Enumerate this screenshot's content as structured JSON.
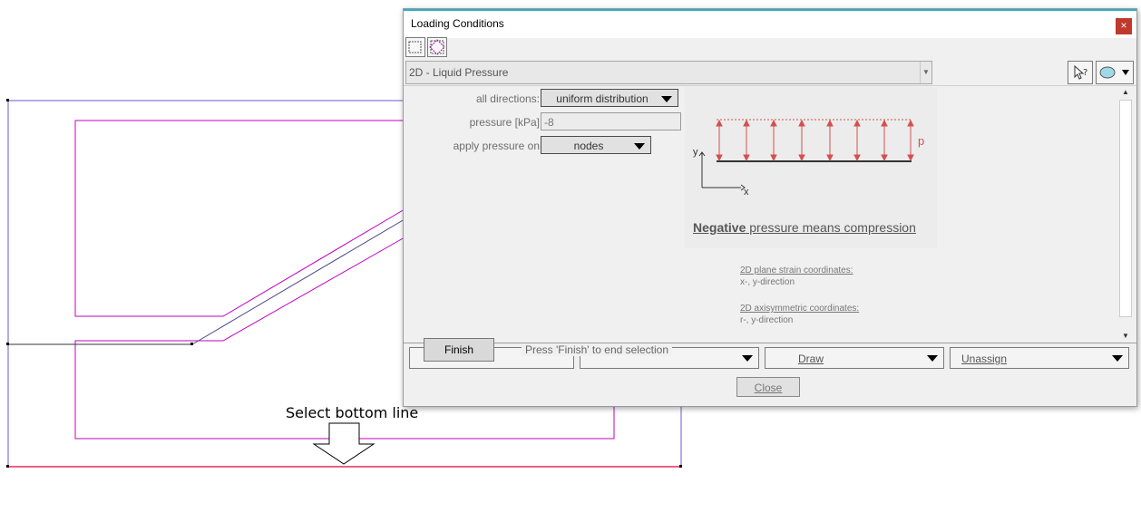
{
  "canvas": {
    "instruction": "Select bottom line"
  },
  "dialog": {
    "title": "Loading Conditions",
    "close_glyph": "×",
    "load_type": "2D - Liquid Pressure",
    "fields": {
      "all_directions_label": "all directions:",
      "all_directions_value": "uniform distribution",
      "pressure_label": "pressure [kPa]",
      "pressure_value": "-8",
      "apply_label": "apply pressure on",
      "apply_value": "nodes"
    },
    "figure": {
      "p_label": "p",
      "y_label": "y",
      "x_label": "x",
      "caption_bold": "Negative",
      "caption_rest": " pressure means compression"
    },
    "notes": {
      "plane_title": "2D plane strain coordinates:",
      "plane_body": "x-, y-direction",
      "axi_title": "2D axisymmetric coordinates:",
      "axi_body": "r-, y-direction"
    },
    "finish": {
      "button": "Finish",
      "message": "Press 'Finish' to end selection"
    },
    "bottom": {
      "draw": "Draw",
      "unassign": "Unassign"
    },
    "close_button": "Close"
  },
  "colors": {
    "boundary": "#6a5acd",
    "region": "#c000c0",
    "selected_line": "#e0003a",
    "pressure_arrows": "#d45050",
    "title_accent": "#2bb0c8"
  },
  "icons": [
    "rect-select-icon",
    "diamond-select-icon",
    "help-pointer-icon",
    "render-3d-icon"
  ]
}
